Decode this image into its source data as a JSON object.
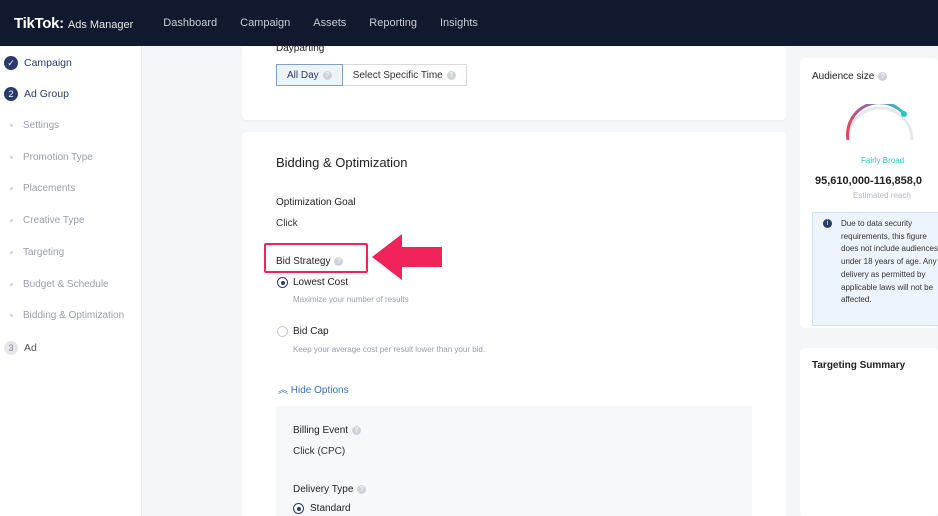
{
  "app": {
    "logo_main": "TikTok",
    "logo_dot": ":",
    "logo_sub": "Ads Manager"
  },
  "nav": [
    "Dashboard",
    "Campaign",
    "Assets",
    "Reporting",
    "Insights"
  ],
  "sidebar": {
    "campaign": "Campaign",
    "adgroup_num": "2",
    "adgroup": "Ad Group",
    "subs": [
      "Settings",
      "Promotion Type",
      "Placements",
      "Creative Type",
      "Targeting",
      "Budget & Schedule",
      "Bidding & Optimization"
    ],
    "ad_num": "3",
    "ad": "Ad"
  },
  "dayparting": {
    "label": "Dayparting",
    "all_day": "All Day",
    "specific": "Select Specific Time"
  },
  "bidding": {
    "title": "Bidding & Optimization",
    "goal_label": "Optimization Goal",
    "goal_value": "Click",
    "bid_strategy_label": "Bid Strategy",
    "lowest_cost": "Lowest Cost",
    "lowest_cost_desc": "Maximize your number of results",
    "bid_cap": "Bid Cap",
    "bid_cap_desc": "Keep your average cost per result lower than your bid.",
    "hide_options": "Hide Options",
    "billing_label": "Billing Event",
    "billing_value": "Click (CPC)",
    "delivery_label": "Delivery Type",
    "delivery_standard": "Standard"
  },
  "audience": {
    "title": "Audience size",
    "level": "Fairly Broad",
    "reach": "95,610,000-116,858,0",
    "reach_sub": "Estimated reach",
    "info": "Due to data security requirements, this figure does not include audiences under 18 years of age. Any delivery as permitted by applicable laws will not be affected."
  },
  "targeting_summary": {
    "title": "Targeting Summary"
  },
  "colors": {
    "topbar": "#10192e",
    "accent": "#2a3a6a",
    "highlight": "#f0245a",
    "gauge": "#2fc5c0"
  }
}
